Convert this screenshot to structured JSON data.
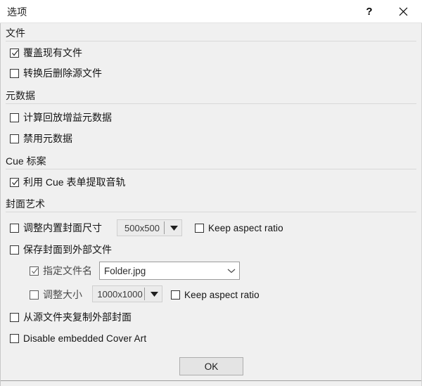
{
  "window": {
    "title": "选项",
    "help_label": "?",
    "close_label": "✕"
  },
  "sections": {
    "files": {
      "title": "文件",
      "overwrite_label": "覆盖现有文件",
      "delete_source_label": "转换后删除源文件"
    },
    "metadata": {
      "title": "元数据",
      "replaygain_label": "计算回放增益元数据",
      "disable_label": "禁用元数据"
    },
    "cue": {
      "title": "Cue 标案",
      "extract_label": "利用 Cue 表单提取音轨"
    },
    "cover_art": {
      "title": "封面艺术",
      "resize_embedded_label": "调整内置封面尺寸",
      "embedded_size_value": "500x500",
      "keep_aspect_1_label": "Keep aspect ratio",
      "save_external_label": "保存封面到外部文件",
      "filename_label": "指定文件名",
      "filename_value": "Folder.jpg",
      "resize_external_label": "调整大小",
      "external_size_value": "1000x1000",
      "keep_aspect_2_label": "Keep aspect ratio",
      "copy_from_source_label": "从源文件夹复制外部封面",
      "disable_embedded_label": "Disable embedded Cover Art"
    }
  },
  "footer": {
    "ok_label": "OK"
  },
  "colors": {
    "dialog_bg": "#F0F0F0",
    "titlebar_bg": "#FFFFFF",
    "text": "#141414",
    "rule": "#D8D8D8",
    "combo_disabled_bg": "#EBEBEB",
    "button_bg": "#E4E4E4"
  }
}
